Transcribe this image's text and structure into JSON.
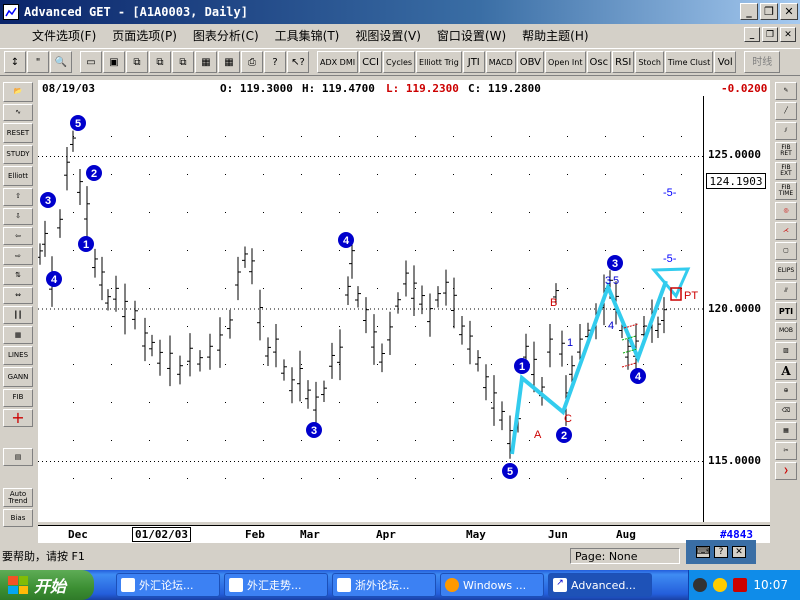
{
  "window": {
    "title": "Advanced GET - [A1A0003, Daily]"
  },
  "menu": {
    "items": [
      "文件选项(F)",
      "页面选项(P)",
      "图表分析(C)",
      "工具集锦(T)",
      "视图设置(V)",
      "窗口设置(W)",
      "帮助主题(H)"
    ]
  },
  "toolbar": {
    "study_buttons": [
      "ADX DMI",
      "CCI",
      "Cycles",
      "Elliott Trig",
      "JTI",
      "MACD",
      "OBV",
      "Open Int",
      "Osc",
      "RSI",
      "Stoch",
      "Time Clust",
      "Vol"
    ],
    "timeline_label": "时线"
  },
  "left_toolbar": {
    "labels": [
      "RESET",
      "STUDY",
      "Elliott",
      "LINES",
      "GANN",
      "FIB",
      "Auto Trend",
      "Bias"
    ]
  },
  "right_toolbar": {
    "labels": [
      "FIB RET",
      "FIB EXT",
      "FIB TIME",
      "ELIPS",
      "PTI",
      "MOB",
      "A"
    ]
  },
  "info_bar": {
    "date": "08/19/03",
    "open": "O: 119.3000",
    "high": "H: 119.4700",
    "low": "L: 119.2300",
    "close": "C: 119.2800",
    "change": "-0.0200"
  },
  "price_axis": {
    "labels": [
      "125.0000",
      "120.0000",
      "115.0000"
    ],
    "current_price": "124.1903"
  },
  "time_axis": {
    "labels": [
      "Dec",
      "01/02/03",
      "Feb",
      "Mar",
      "Apr",
      "May",
      "Jun",
      "Aug"
    ],
    "bar_counter": "#4843"
  },
  "chart_data": {
    "type": "bar",
    "title": "",
    "price_levels": [
      125.0,
      120.0,
      115.0
    ],
    "ylim": [
      113.0,
      127.0
    ],
    "wave_labels_blue_circles": [
      "5",
      "3",
      "2",
      "1",
      "4",
      "3",
      "4",
      "3",
      "1",
      "2",
      "5",
      "3",
      "4"
    ],
    "wave_labels_text": [
      "B",
      "A",
      "C",
      "1",
      "3",
      "5",
      "4"
    ],
    "projection_labels": [
      "-5-",
      "-5-",
      "PT"
    ],
    "colors": {
      "bars": "#000000",
      "wave_circle": "#0000cc",
      "abc_labels": "#cc0000",
      "impulse_path": "#33ccee",
      "projection": "#0000ff",
      "change_text": "#cc0000"
    }
  },
  "status": {
    "help": "要帮助，请按 F1",
    "page": "Page: None"
  },
  "taskbar": {
    "start_label": "开始",
    "items": [
      "外汇论坛...",
      "外汇走势...",
      "浙外论坛...",
      "Windows ...",
      "Advanced..."
    ],
    "clock": "10:07"
  }
}
